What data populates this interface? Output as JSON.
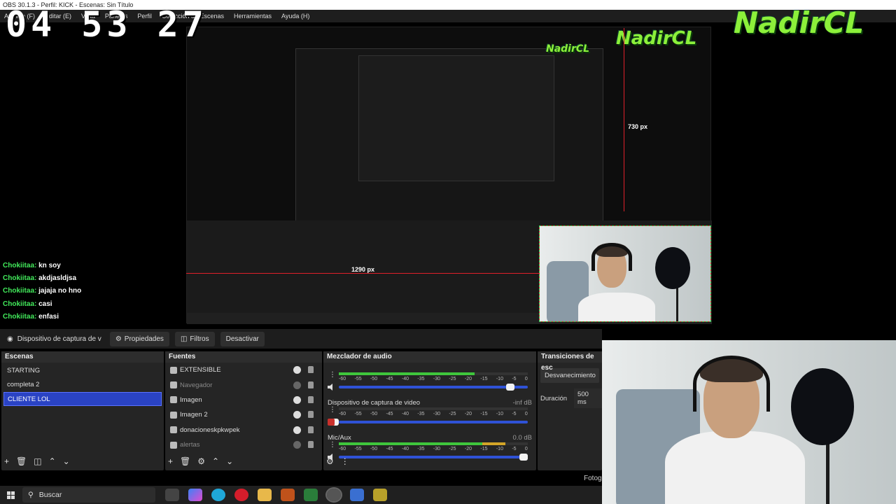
{
  "window": {
    "title": "OBS 30.1.3 - Perfil: KICK - Escenas: Sin Título"
  },
  "menu": [
    "Archivo (F)",
    "Editar (E)",
    "Vista",
    "Paneles",
    "Perfil",
    "Colección de Escenas",
    "Herramientas",
    "Ayuda (H)"
  ],
  "overlay": {
    "clock": "04 53 27",
    "logo": "NadirCL",
    "measure_label": "730 px",
    "measure_label_small": "1290 px"
  },
  "chat": [
    {
      "nick": "Chokiitaa:",
      "msg": "kn soy"
    },
    {
      "nick": "Chokiitaa:",
      "msg": "akdjasldjsa"
    },
    {
      "nick": "Chokiitaa:",
      "msg": "jajaja no hno"
    },
    {
      "nick": "Chokiitaa:",
      "msg": "casi"
    },
    {
      "nick": "Chokiitaa:",
      "msg": "enfasi"
    }
  ],
  "dock": {
    "source_name": "Dispositivo de captura de v",
    "properties": "Propiedades",
    "filters": "Filtros",
    "deactivate": "Desactivar"
  },
  "scenes": {
    "title": "Escenas",
    "items": [
      "STARTING",
      "completa 2",
      "CLIENTE LOL"
    ],
    "selected_index": 2
  },
  "sources": {
    "title": "Fuentes",
    "items": [
      {
        "name": "EXTENSIBLE",
        "visible": true
      },
      {
        "name": "Navegador",
        "visible": false
      },
      {
        "name": "Imagen",
        "visible": true
      },
      {
        "name": "Imagen 2",
        "visible": true
      },
      {
        "name": "donacioneskpkwpek",
        "visible": true
      },
      {
        "name": "alertas",
        "visible": false
      }
    ]
  },
  "mixer": {
    "title": "Mezclador de audio",
    "scale": [
      "-60",
      "-55",
      "-50",
      "-45",
      "-40",
      "-35",
      "-30",
      "-25",
      "-20",
      "-15",
      "-10",
      "-5",
      "0"
    ],
    "channels": [
      {
        "name": "",
        "db": "",
        "level": 0.72,
        "fader": 0.93,
        "muted": false
      },
      {
        "name": "Dispositivo de captura de video",
        "db": "-inf dB",
        "level": 0.0,
        "fader": 0.0,
        "muted": true
      },
      {
        "name": "Mic/Aux",
        "db": "0.0 dB",
        "level": 0.88,
        "fader": 1.0,
        "muted": false
      }
    ]
  },
  "transitions": {
    "title": "Transiciones de esc",
    "selected": "Desvanecimiento",
    "duration_label": "Duración",
    "duration_value": "500 ms"
  },
  "status": {
    "foto": "Fotogr"
  },
  "taskbar": {
    "search": "Buscar"
  },
  "colors": {
    "accent": "#2a43c4",
    "chat_nick": "#42ea5b",
    "logo": "#8cf03a",
    "guide": "#e0202a"
  }
}
